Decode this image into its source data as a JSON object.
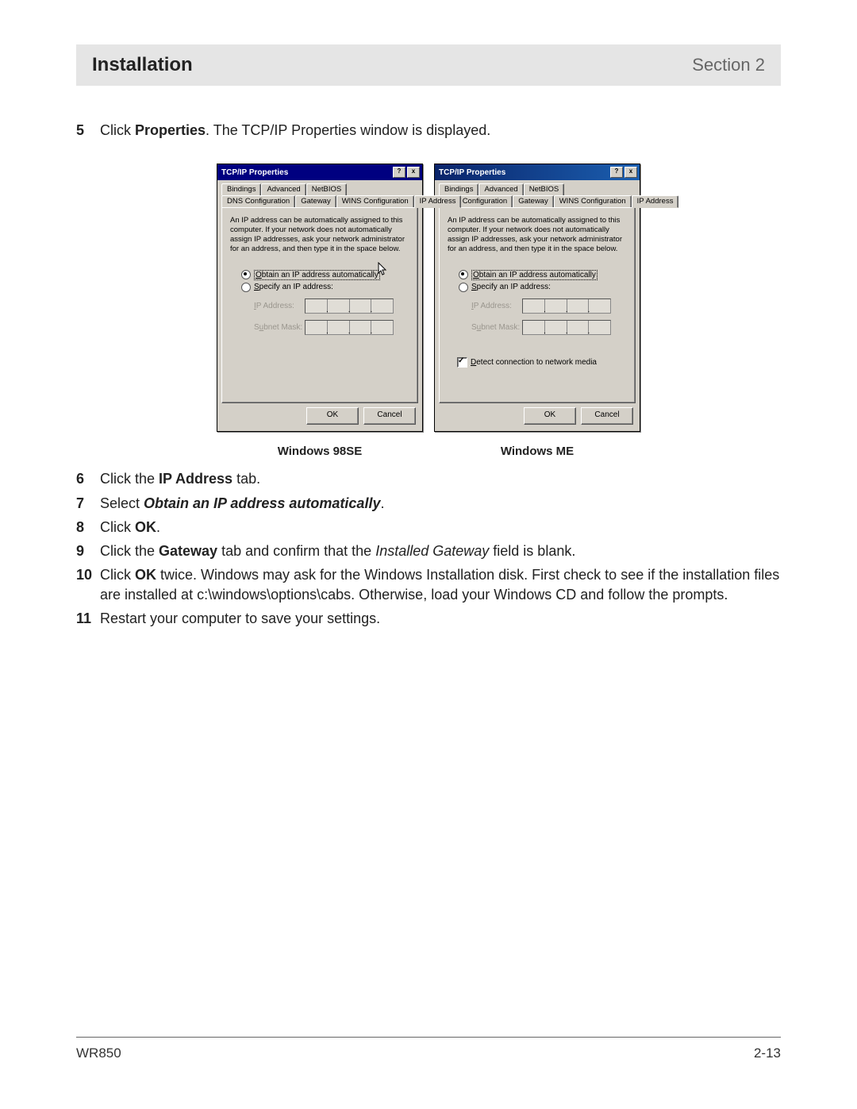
{
  "header": {
    "title": "Installation",
    "section": "Section 2"
  },
  "steps": {
    "s5": {
      "num": "5",
      "pre": "Click ",
      "bold1": "Properties",
      "post": ". The TCP/IP Properties window is displayed."
    },
    "s6": {
      "num": "6",
      "pre": "Click the ",
      "bold1": "IP Address",
      "post": " tab."
    },
    "s7": {
      "num": "7",
      "pre": "Select ",
      "bi1": "Obtain an IP address automatically",
      "post": "."
    },
    "s8": {
      "num": "8",
      "pre": "Click ",
      "bold1": "OK",
      "post": "."
    },
    "s9": {
      "num": "9",
      "pre": "Click the ",
      "bold1": "Gateway",
      "mid": " tab and confirm that the ",
      "ital1": "Installed Gateway",
      "post": " field is blank."
    },
    "s10": {
      "num": "10",
      "pre": "Click ",
      "bold1": "OK",
      "post": " twice. Windows may ask for the Windows Installation disk. First check to see if the installation files are installed at c:\\windows\\options\\cabs. Otherwise, load your Windows CD and follow the prompts."
    },
    "s11": {
      "num": "11",
      "text": "Restart your computer to save your settings."
    }
  },
  "captions": {
    "left": "Windows 98SE",
    "right": "Windows ME"
  },
  "dialog": {
    "title": "TCP/IP Properties",
    "help_btn": "?",
    "close_btn": "x",
    "tabs_row1": {
      "bindings": "Bindings",
      "advanced": "Advanced",
      "netbios": "NetBIOS"
    },
    "tabs_row2": {
      "dns": "DNS Configuration",
      "gateway": "Gateway",
      "wins": "WINS Configuration",
      "ip": "IP Address"
    },
    "desc": "An IP address can be automatically assigned to this computer. If your network does not automatically assign IP addresses, ask your network administrator for an address, and then type it in the space below.",
    "radio_obtain_pre_u": "O",
    "radio_obtain_rest": "btain an IP address automatically",
    "radio_specify_pre_u": "S",
    "radio_specify_rest": "pecify an IP address:",
    "label_ip_pre": "I",
    "label_ip_rest": "P Address:",
    "label_mask_pre_u": "u",
    "label_mask": "Subnet Mask:",
    "detect_pre_u": "D",
    "detect_rest": "etect connection to network media",
    "ok": "OK",
    "cancel": "Cancel"
  },
  "footer": {
    "left": "WR850",
    "right": "2-13"
  }
}
